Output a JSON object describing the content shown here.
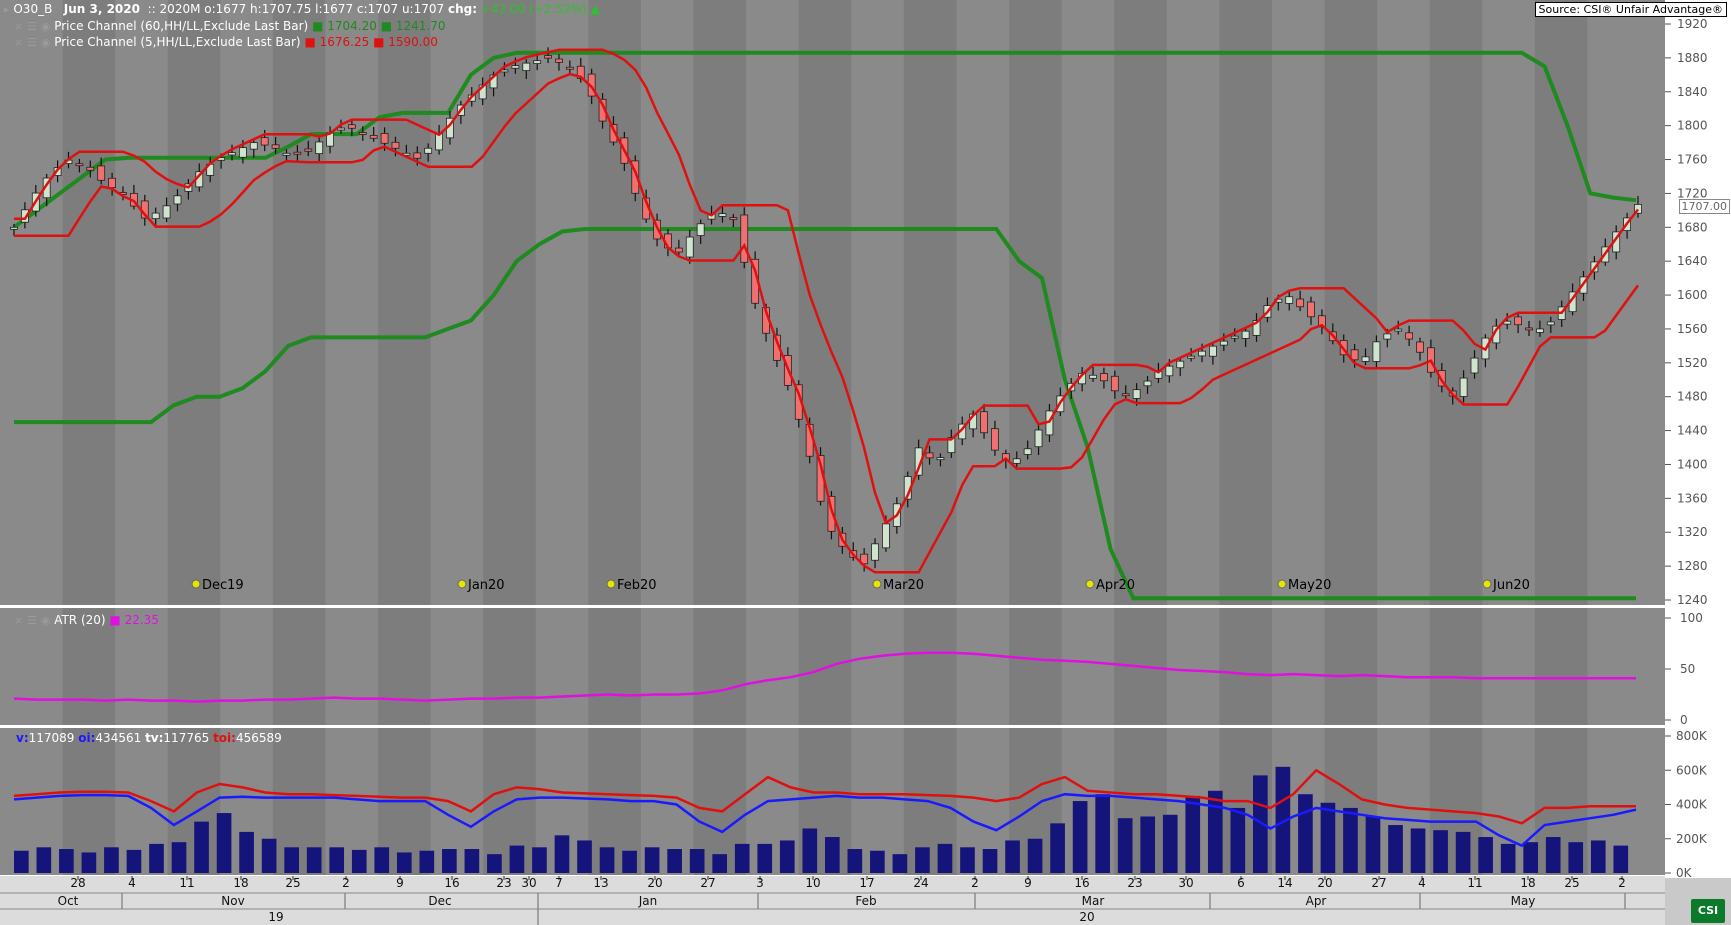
{
  "header": {
    "symbol": "O30_B",
    "date": "Jun 3, 2020",
    "sep": "::",
    "contract": "2020M",
    "o_label": "o:",
    "o": "1677",
    "h_label": "h:",
    "h": "1707.75",
    "l_label": "l:",
    "l": "1677",
    "c_label": "c:",
    "c": "1707",
    "u_label": "u:",
    "u": "1707",
    "chg_label": "chg:",
    "chg": "+42.00 (+2.52%)"
  },
  "source": "Source: CSI® Unfair Advantage®",
  "indicators": [
    {
      "label": "Price Channel (60,HH/LL,Exclude Last Bar)",
      "v1": "1704.20",
      "v2": "1241.70",
      "color": "#1f8a1f"
    },
    {
      "label": "Price Channel (5,HH/LL,Exclude Last Bar)",
      "v1": "1676.25",
      "v2": "1590.00",
      "color": "#e01010"
    }
  ],
  "atr": {
    "label": "ATR (20)",
    "value": "22.35",
    "color": "#e010e0"
  },
  "volume_header": {
    "v_label": "v:",
    "v": "117089",
    "oi_label": "oi:",
    "oi": "434561",
    "tv_label": "tv:",
    "tv": "117765",
    "toi_label": "toi:",
    "toi": "456589"
  },
  "last_price_tag": "1707.00",
  "colors": {
    "up": "#cfe3cf",
    "down": "#f07070",
    "channel60": "#1f8a1f",
    "channel5": "#e01010",
    "atr": "#e010e0",
    "vol": "#14147a",
    "oi": "#1a1aff",
    "toi": "#e01010",
    "bg_a": "#8a8a8a",
    "bg_b": "#7d7d7d"
  },
  "chart_data": [
    {
      "type": "candlestick",
      "title": "",
      "ylim": [
        1240,
        1920
      ],
      "y_ticks": [
        "1920",
        "1880",
        "1840",
        "1800",
        "1760",
        "1720",
        "1680",
        "1640",
        "1600",
        "1560",
        "1520",
        "1480",
        "1440",
        "1400",
        "1360",
        "1320",
        "1280",
        "1240"
      ],
      "month_markers": [
        "Dec19",
        "Jan20",
        "Feb20",
        "Mar20",
        "Apr20",
        "May20",
        "Jun20"
      ],
      "series": [
        {
          "name": "Price Channel (60,HH/LL,Exclude Last Bar) upper",
          "values_sampled": [
            1680,
            1700,
            1720,
            1740,
            1760,
            1762,
            1762,
            1762,
            1762,
            1762,
            1762,
            1762,
            1775,
            1790,
            1790,
            1790,
            1810,
            1815,
            1815,
            1815,
            1860,
            1880,
            1886,
            1886,
            1886,
            1886,
            1886,
            1886,
            1886,
            1886,
            1886,
            1886,
            1886,
            1886,
            1886,
            1886,
            1886,
            1886,
            1886,
            1886,
            1886,
            1886,
            1886,
            1886,
            1886,
            1886,
            1886,
            1886,
            1886,
            1886,
            1886,
            1886,
            1886,
            1886,
            1886,
            1886,
            1886,
            1886,
            1886,
            1886,
            1886,
            1886,
            1886,
            1886,
            1886,
            1886,
            1886,
            1870,
            1800,
            1720,
            1715,
            1712
          ]
        },
        {
          "name": "Price Channel (60,HH/LL,Exclude Last Bar) lower",
          "values_sampled": [
            1450,
            1450,
            1450,
            1450,
            1450,
            1450,
            1450,
            1470,
            1480,
            1480,
            1490,
            1510,
            1540,
            1550,
            1550,
            1550,
            1550,
            1550,
            1550,
            1560,
            1570,
            1600,
            1640,
            1660,
            1675,
            1678,
            1678,
            1678,
            1678,
            1678,
            1678,
            1678,
            1678,
            1678,
            1678,
            1678,
            1678,
            1678,
            1678,
            1678,
            1678,
            1678,
            1678,
            1678,
            1640,
            1620,
            1500,
            1420,
            1300,
            1242,
            1242,
            1242,
            1242,
            1242,
            1242,
            1242,
            1242,
            1242,
            1242,
            1242,
            1242,
            1242,
            1242,
            1242,
            1242,
            1242,
            1242,
            1242,
            1242,
            1242,
            1242,
            1242
          ]
        }
      ]
    },
    {
      "type": "line",
      "title": "ATR (20)",
      "ylim": [
        0,
        100
      ],
      "y_ticks": [
        "100",
        "50",
        "0"
      ],
      "series": [
        {
          "name": "ATR (20)",
          "values": [
            21,
            20,
            20,
            20,
            19,
            20,
            19,
            19,
            18,
            19,
            19,
            20,
            20,
            21,
            22,
            21,
            21,
            20,
            19,
            20,
            21,
            21,
            22,
            22,
            23,
            24,
            25,
            24,
            25,
            25,
            26,
            29,
            35,
            39,
            42,
            47,
            55,
            60,
            63,
            65,
            66,
            66,
            65,
            63,
            61,
            59,
            58,
            57,
            55,
            53,
            51,
            49,
            48,
            47,
            45,
            44,
            45,
            44,
            43,
            44,
            43,
            42,
            42,
            42,
            41,
            41,
            41,
            41,
            41,
            41,
            41,
            41
          ]
        }
      ]
    },
    {
      "type": "bar",
      "title": "Volume / Open Interest",
      "ylim": [
        0,
        800000
      ],
      "y_ticks": [
        "800K",
        "600K",
        "400K",
        "200K",
        "0K"
      ],
      "x_day_labels": [
        "28",
        "4",
        "11",
        "18",
        "25",
        "2",
        "9",
        "16",
        "23",
        "30",
        "7",
        "13",
        "20",
        "27",
        "3",
        "10",
        "17",
        "24",
        "2",
        "9",
        "16",
        "23",
        "30",
        "6",
        "14",
        "20",
        "27",
        "4",
        "11",
        "18",
        "25",
        "2"
      ],
      "x_month_labels": [
        "Oct",
        "Nov",
        "Dec",
        "Jan",
        "Feb",
        "Mar",
        "Apr",
        "May"
      ],
      "x_year_labels": [
        "19",
        "20"
      ],
      "series": [
        {
          "name": "v",
          "values": [
            130,
            150,
            140,
            120,
            150,
            135,
            170,
            180,
            300,
            350,
            240,
            200,
            150,
            150,
            150,
            135,
            150,
            120,
            130,
            140,
            140,
            110,
            160,
            150,
            220,
            190,
            150,
            130,
            150,
            140,
            140,
            110,
            170,
            170,
            190,
            260,
            210,
            140,
            130,
            110,
            150,
            170,
            150,
            140,
            190,
            200,
            290,
            420,
            460,
            320,
            330,
            340,
            450,
            480,
            380,
            570,
            620,
            460,
            410,
            380,
            330,
            280,
            260,
            250,
            240,
            210,
            170,
            180,
            210,
            180,
            190,
            160
          ]
        },
        {
          "name": "oi",
          "values": [
            430,
            440,
            450,
            455,
            455,
            450,
            380,
            280,
            360,
            440,
            445,
            440,
            440,
            440,
            440,
            430,
            420,
            420,
            420,
            340,
            270,
            360,
            430,
            440,
            440,
            435,
            430,
            420,
            420,
            400,
            300,
            240,
            340,
            420,
            430,
            440,
            450,
            440,
            440,
            430,
            420,
            380,
            300,
            250,
            330,
            420,
            460,
            450,
            450,
            440,
            430,
            420,
            400,
            380,
            340,
            260,
            330,
            380,
            360,
            340,
            320,
            310,
            300,
            300,
            300,
            220,
            160,
            280,
            300,
            320,
            340,
            370
          ]
        },
        {
          "name": "toi",
          "values": [
            450,
            460,
            470,
            475,
            475,
            470,
            420,
            360,
            470,
            520,
            500,
            470,
            460,
            460,
            455,
            450,
            445,
            440,
            440,
            420,
            360,
            460,
            500,
            490,
            470,
            465,
            460,
            455,
            450,
            440,
            380,
            360,
            460,
            560,
            500,
            470,
            470,
            460,
            460,
            460,
            455,
            450,
            440,
            420,
            440,
            520,
            560,
            480,
            470,
            460,
            460,
            450,
            440,
            420,
            420,
            380,
            460,
            600,
            520,
            430,
            400,
            380,
            370,
            360,
            350,
            330,
            290,
            380,
            380,
            390,
            390,
            390
          ]
        }
      ]
    }
  ]
}
